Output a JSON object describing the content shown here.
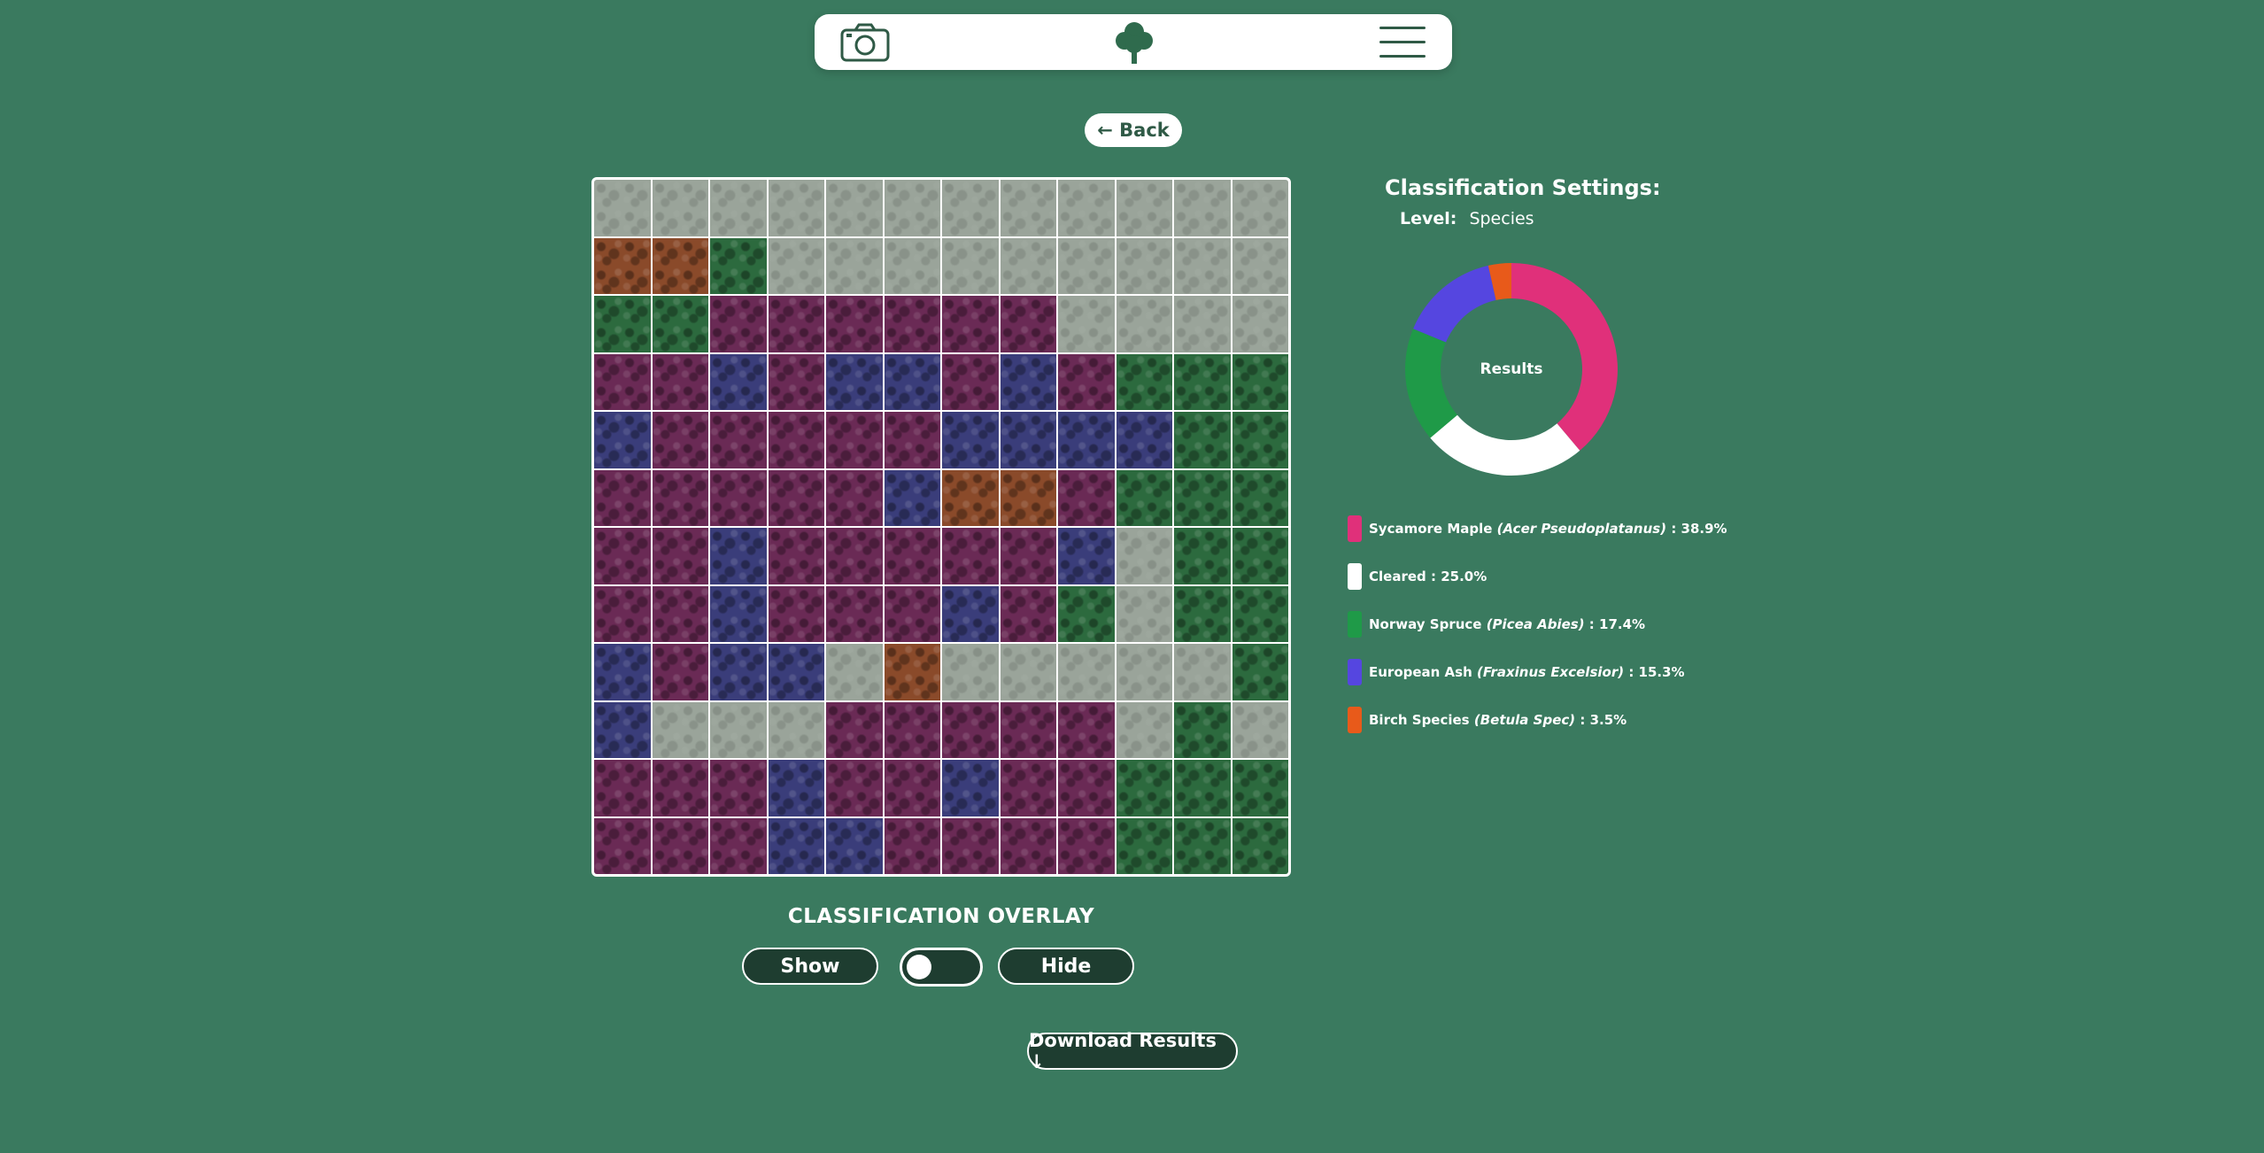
{
  "nav": {
    "camera_icon": "camera-icon",
    "logo_icon": "tree-icon",
    "menu_icon": "hamburger-menu-icon"
  },
  "back_label": "← Back",
  "settings": {
    "title": "Classification Settings:",
    "level_label": "Level:",
    "level_value": "Species"
  },
  "donut": {
    "center_label": "Results"
  },
  "chart_data": {
    "type": "pie",
    "title": "",
    "categories": [
      "Sycamore Maple",
      "Cleared",
      "Norway Spruce",
      "European Ash",
      "Birch Species"
    ],
    "values": [
      38.9,
      25.0,
      17.4,
      15.3,
      3.5
    ],
    "colors": [
      "#e0307a",
      "#ffffff",
      "#1f9a48",
      "#5546e0",
      "#e85a1a"
    ]
  },
  "legend": [
    {
      "name": "Sycamore Maple",
      "latin": "(Acer Pseudoplatanus)",
      "value": ": 38.9%",
      "color": "#e0307a"
    },
    {
      "name": "Cleared",
      "latin": "",
      "value": ": 25.0%",
      "color": "#ffffff"
    },
    {
      "name": "Norway Spruce",
      "latin": "(Picea Abies)",
      "value": ": 17.4%",
      "color": "#1f9a48"
    },
    {
      "name": "European Ash",
      "latin": "(Fraxinus Excelsior)",
      "value": ": 15.3%",
      "color": "#5546e0"
    },
    {
      "name": "Birch Species",
      "latin": "(Betula Spec)",
      "value": ": 3.5%",
      "color": "#e85a1a"
    }
  ],
  "overlay": {
    "title": "CLASSIFICATION OVERLAY",
    "show_label": "Show",
    "hide_label": "Hide"
  },
  "download_label": "Download Results ↓"
}
